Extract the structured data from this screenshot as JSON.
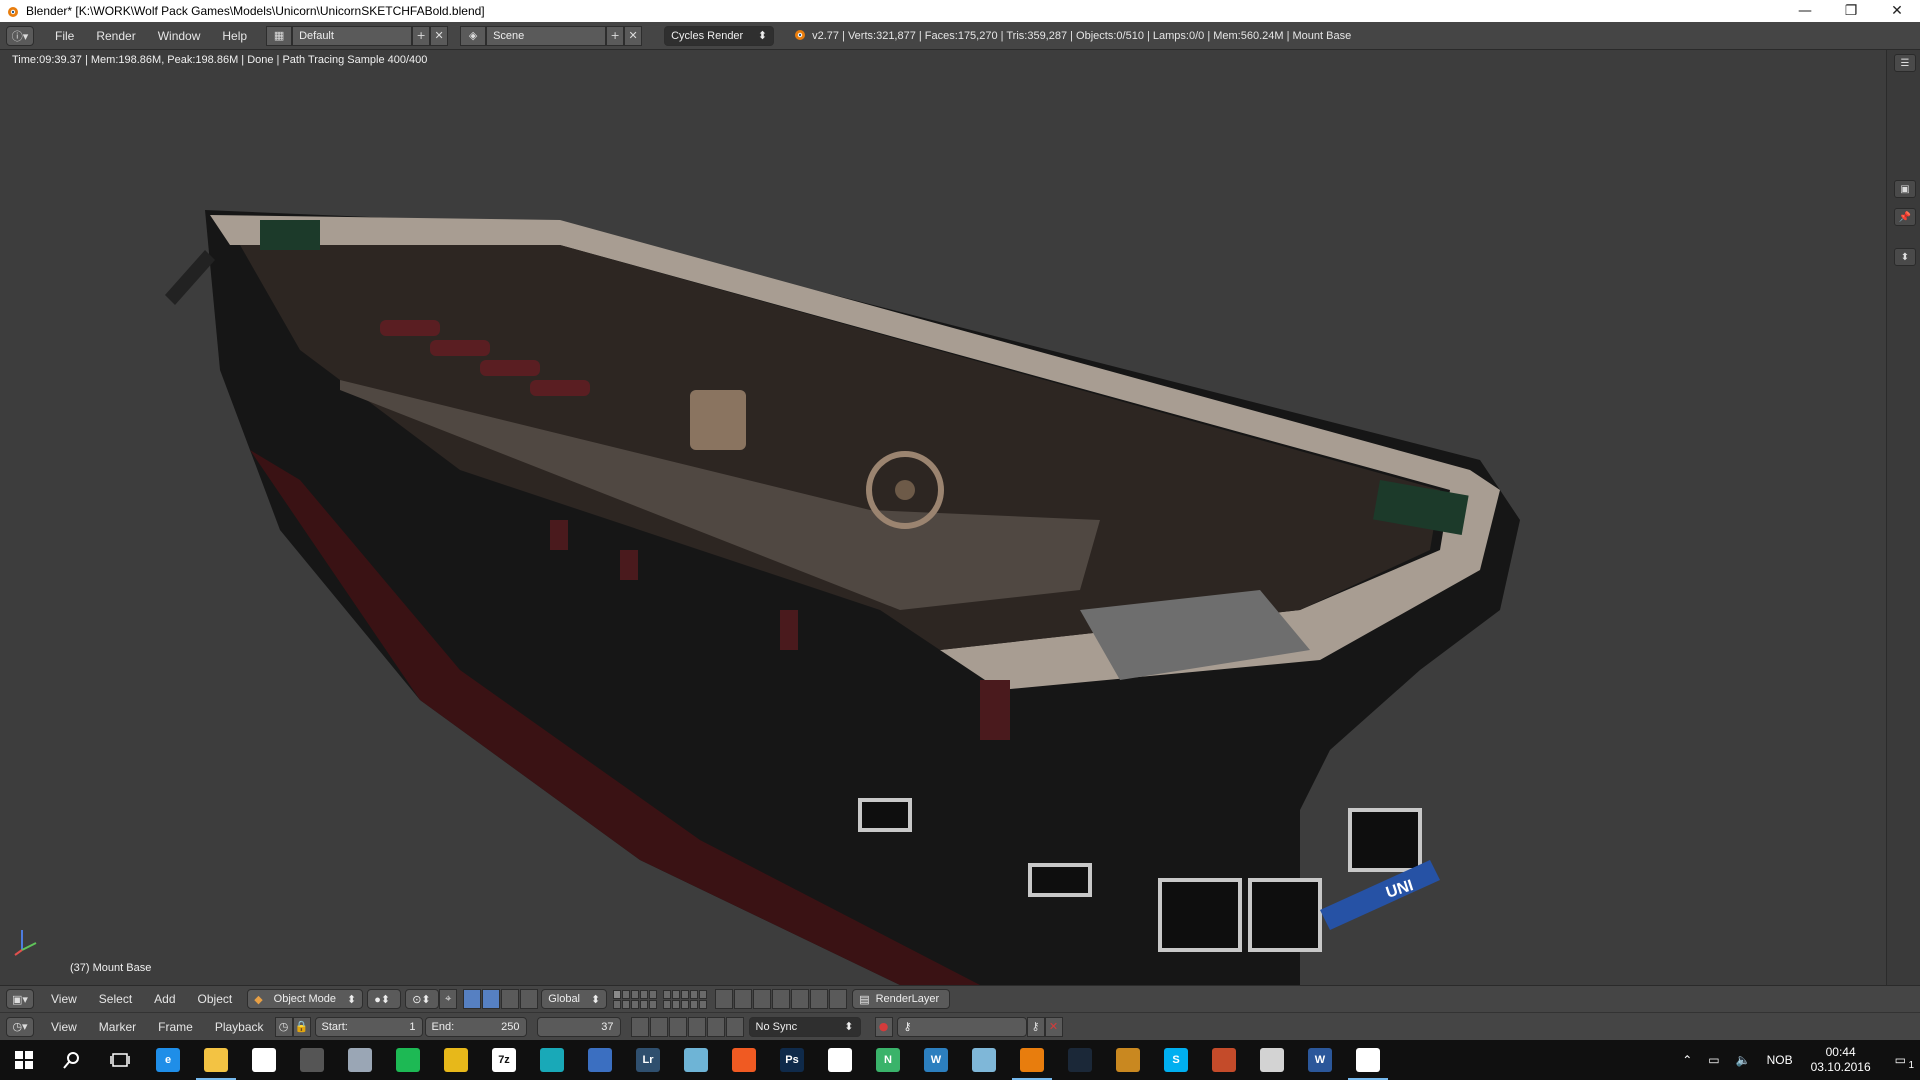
{
  "window": {
    "title": "Blender* [K:\\WORK\\Wolf Pack Games\\Models\\Unicorn\\UnicornSKETCHFABold.blend]",
    "minimize": "—",
    "restore": "❐",
    "close": "✕"
  },
  "info_header": {
    "menus": [
      "File",
      "Render",
      "Window",
      "Help"
    ],
    "layout": "Default",
    "scene": "Scene",
    "render_engine": "Cycles Render",
    "stats": "v2.77 | Verts:321,877 | Faces:175,270 | Tris:359,287 | Objects:0/510 | Lamps:0/0 | Mem:560.24M | Mount Base"
  },
  "viewport": {
    "render_status": "Time:09:39.37 | Mem:198.86M, Peak:198.86M | Done | Path Tracing Sample 400/400",
    "object_label": "(37) Mount Base",
    "ship_name_fragment": "UNI"
  },
  "view3d_header": {
    "menus": [
      "View",
      "Select",
      "Add",
      "Object"
    ],
    "mode": "Object Mode",
    "orientation": "Global",
    "render_layer": "RenderLayer"
  },
  "timeline_header": {
    "menus": [
      "View",
      "Marker",
      "Frame",
      "Playback"
    ],
    "start_label": "Start:",
    "start_value": "1",
    "end_label": "End:",
    "end_value": "250",
    "current_frame": "37",
    "sync": "No Sync"
  },
  "taskbar": {
    "language": "NOB",
    "time": "00:44",
    "date": "03.10.2016",
    "notification_count": "1",
    "apps": [
      {
        "name": "start-icon",
        "label": "",
        "color": "#ffffff"
      },
      {
        "name": "search-icon",
        "label": "",
        "color": "#ffffff"
      },
      {
        "name": "task-view-icon",
        "label": "",
        "color": "#ffffff"
      },
      {
        "name": "edge-icon",
        "label": "e",
        "color": "#1f8ee8"
      },
      {
        "name": "file-explorer-icon",
        "label": "",
        "color": "#f3c343"
      },
      {
        "name": "store-icon",
        "label": "",
        "color": "#ffffff"
      },
      {
        "name": "steam-alt-icon",
        "label": "",
        "color": "#555555"
      },
      {
        "name": "app-arrow-icon",
        "label": "",
        "color": "#9aa6b5"
      },
      {
        "name": "spotify-icon",
        "label": "",
        "color": "#1db954"
      },
      {
        "name": "chrome-icon",
        "label": "",
        "color": "#e7b81a"
      },
      {
        "name": "7zip-icon",
        "label": "7z",
        "color": "#ffffff"
      },
      {
        "name": "maya-icon",
        "label": "",
        "color": "#19a9b8"
      },
      {
        "name": "pen-icon",
        "label": "",
        "color": "#3b6fc1"
      },
      {
        "name": "lightroom-icon",
        "label": "Lr",
        "color": "#2f4f6e"
      },
      {
        "name": "notes-icon",
        "label": "",
        "color": "#6eb4d6"
      },
      {
        "name": "origin-icon",
        "label": "",
        "color": "#f05a22"
      },
      {
        "name": "photoshop-icon",
        "label": "Ps",
        "color": "#0f2a4a"
      },
      {
        "name": "eye-app-icon",
        "label": "",
        "color": "#ffffff"
      },
      {
        "name": "n-app-icon",
        "label": "N",
        "color": "#3ab36a"
      },
      {
        "name": "wordpress-icon",
        "label": "W",
        "color": "#2c7fbf"
      },
      {
        "name": "paint-icon",
        "label": "",
        "color": "#7fb7d8"
      },
      {
        "name": "blender-icon",
        "label": "",
        "color": "#e87d0d"
      },
      {
        "name": "steam-icon",
        "label": "",
        "color": "#1b2838"
      },
      {
        "name": "archive-icon",
        "label": "",
        "color": "#c98820"
      },
      {
        "name": "skype-icon",
        "label": "S",
        "color": "#00aff0"
      },
      {
        "name": "game-icon",
        "label": "",
        "color": "#c44b2a"
      },
      {
        "name": "sketch-app-icon",
        "label": "",
        "color": "#d3d3d3"
      },
      {
        "name": "word-icon",
        "label": "W",
        "color": "#2b579a"
      },
      {
        "name": "photos-icon",
        "label": "",
        "color": "#ffffff"
      }
    ]
  }
}
